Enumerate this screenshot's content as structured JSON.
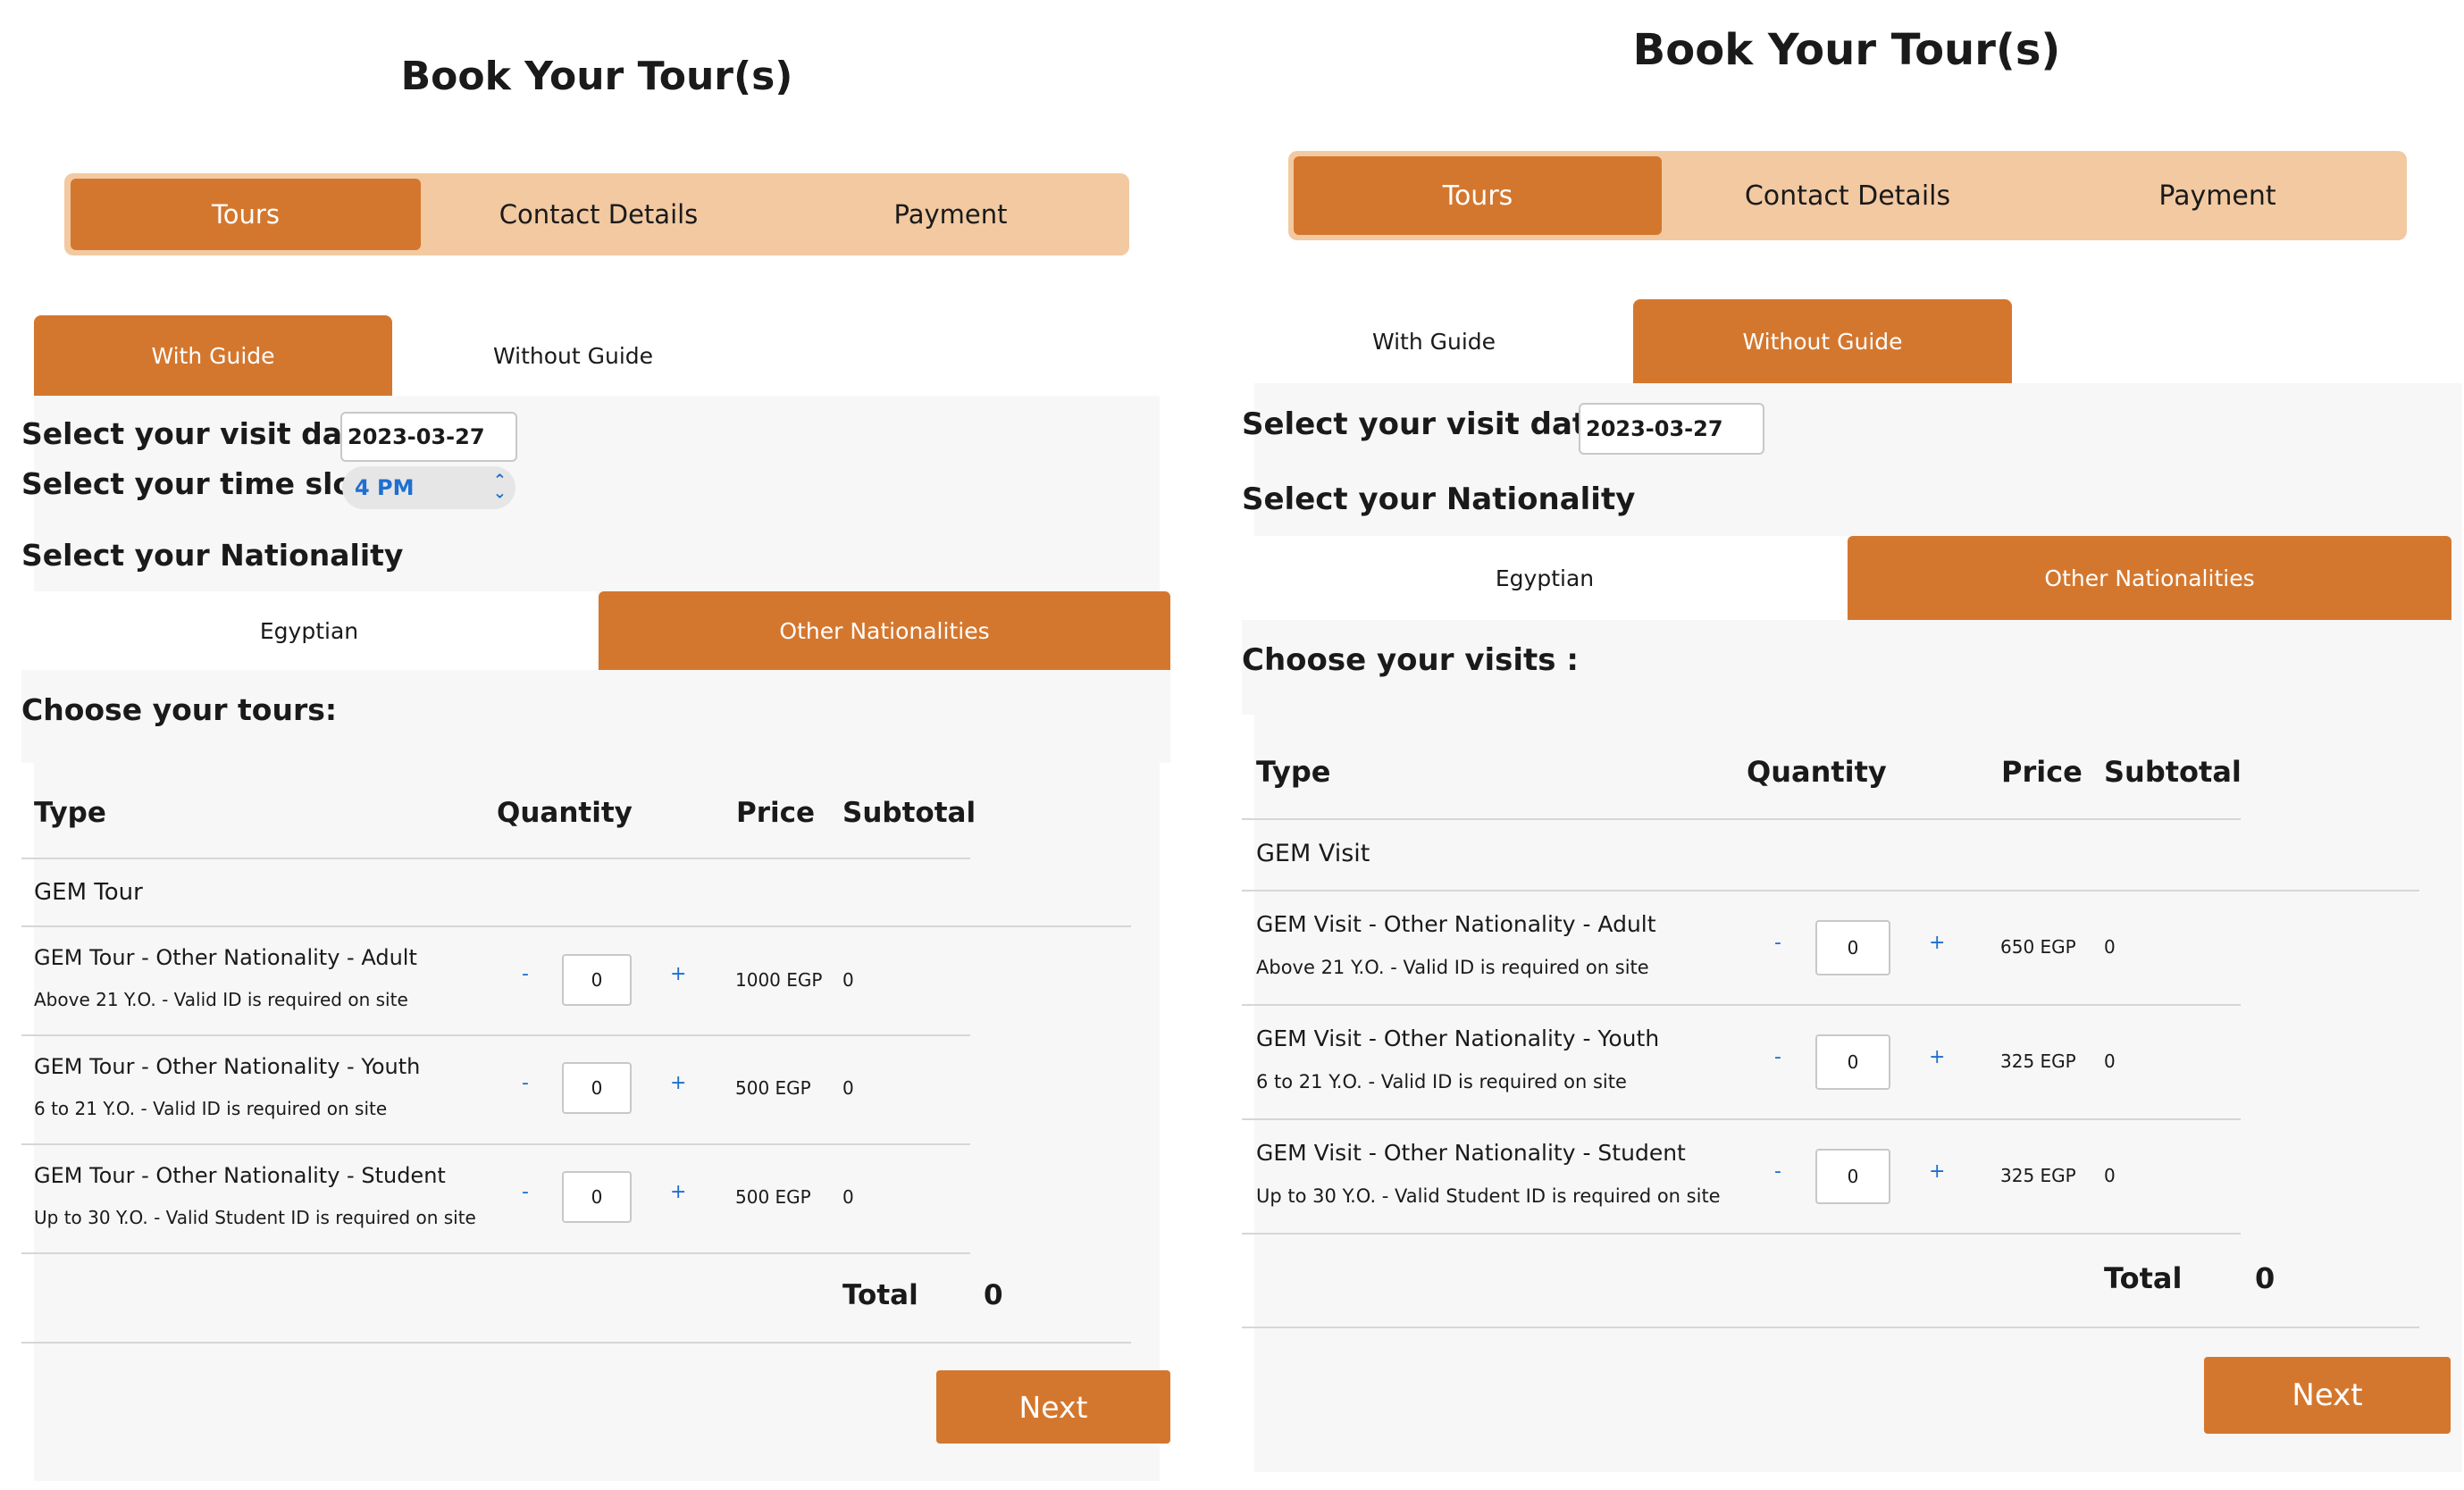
{
  "colors": {
    "accent": "#d4772e",
    "accent_light": "#f2c9a1",
    "panel_bg": "#f7f7f7",
    "link_blue": "#1f6fd1"
  },
  "left": {
    "title": "Book Your Tour(s)",
    "steps": [
      "Tours",
      "Contact Details",
      "Payment"
    ],
    "guide_tabs": [
      "With Guide",
      "Without Guide"
    ],
    "date_label": "Select your visit date :",
    "date_value": "2023-03-27",
    "time_label": "Select your time slot :",
    "time_value": "4 PM",
    "nationality_label": "Select your Nationality",
    "nationality_tabs": [
      "Egyptian",
      "Other Nationalities"
    ],
    "choose_label": "Choose your tours:",
    "headers": {
      "type": "Type",
      "quantity": "Quantity",
      "price": "Price",
      "subtotal": "Subtotal"
    },
    "group": "GEM Tour",
    "rows": [
      {
        "name": "GEM Tour - Other Nationality - Adult",
        "note": "Above 21 Y.O. - Valid ID is required on site",
        "minus": "-",
        "qty": "0",
        "plus": "+",
        "price": "1000 EGP",
        "subtotal": "0"
      },
      {
        "name": "GEM Tour - Other Nationality - Youth",
        "note": "6 to 21 Y.O. - Valid ID is required on site",
        "minus": "-",
        "qty": "0",
        "plus": "+",
        "price": "500 EGP",
        "subtotal": "0"
      },
      {
        "name": "GEM Tour - Other Nationality - Student",
        "note": "Up to 30 Y.O. - Valid Student ID is required on site",
        "minus": "-",
        "qty": "0",
        "plus": "+",
        "price": "500 EGP",
        "subtotal": "0"
      }
    ],
    "total_label": "Total",
    "total_value": "0",
    "next": "Next"
  },
  "right": {
    "title": "Book Your Tour(s)",
    "steps": [
      "Tours",
      "Contact Details",
      "Payment"
    ],
    "guide_tabs": [
      "With Guide",
      "Without Guide"
    ],
    "date_label": "Select your visit date :",
    "date_value": "2023-03-27",
    "nationality_label": "Select your Nationality",
    "nationality_tabs": [
      "Egyptian",
      "Other Nationalities"
    ],
    "choose_label": "Choose your visits :",
    "headers": {
      "type": "Type",
      "quantity": "Quantity",
      "price": "Price",
      "subtotal": "Subtotal"
    },
    "group": "GEM Visit",
    "rows": [
      {
        "name": "GEM Visit - Other Nationality - Adult",
        "note": "Above 21 Y.O. - Valid ID is required on site",
        "minus": "-",
        "qty": "0",
        "plus": "+",
        "price": "650 EGP",
        "subtotal": "0"
      },
      {
        "name": "GEM Visit - Other Nationality - Youth",
        "note": "6 to 21 Y.O. - Valid ID is required on site",
        "minus": "-",
        "qty": "0",
        "plus": "+",
        "price": "325 EGP",
        "subtotal": "0"
      },
      {
        "name": "GEM Visit - Other Nationality - Student",
        "note": "Up to 30 Y.O. - Valid Student ID is required on site",
        "minus": "-",
        "qty": "0",
        "plus": "+",
        "price": "325 EGP",
        "subtotal": "0"
      }
    ],
    "total_label": "Total",
    "total_value": "0",
    "next": "Next"
  }
}
